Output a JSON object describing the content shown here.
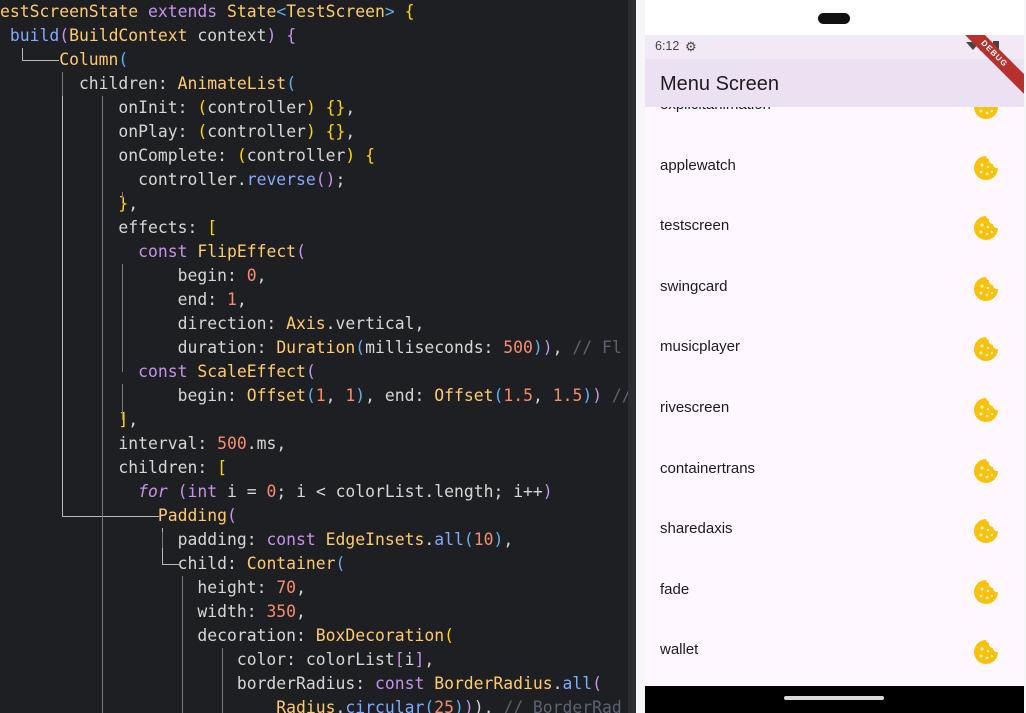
{
  "code_lines": [
    {
      "indent": 0,
      "tokens": [
        {
          "t": "estScreenState ",
          "c": "ty"
        },
        {
          "t": "extends ",
          "c": "kw"
        },
        {
          "t": "State",
          "c": "ty"
        },
        {
          "t": "<",
          "c": "br3"
        },
        {
          "t": "TestScreen",
          "c": "ty"
        },
        {
          "t": "> ",
          "c": "br3"
        },
        {
          "t": "{",
          "c": "br"
        }
      ]
    },
    {
      "indent": 0,
      "tokens": [
        {
          "t": " build",
          "c": "fn"
        },
        {
          "t": "(",
          "c": "br2"
        },
        {
          "t": "BuildContext ",
          "c": "ty"
        },
        {
          "t": "context",
          "c": ""
        },
        {
          "t": ") ",
          "c": "br2"
        },
        {
          "t": "{",
          "c": "br2"
        }
      ]
    },
    {
      "indent": 0,
      "tokens": [
        {
          "t": "      Column",
          "c": "ty"
        },
        {
          "t": "(",
          "c": "br3"
        }
      ]
    },
    {
      "indent": 0,
      "tokens": [
        {
          "t": "        children: ",
          "c": ""
        },
        {
          "t": "AnimateList",
          "c": "ty"
        },
        {
          "t": "(",
          "c": "br3"
        }
      ]
    },
    {
      "indent": 0,
      "tokens": [
        {
          "t": "            onInit: ",
          "c": ""
        },
        {
          "t": "(",
          "c": "br"
        },
        {
          "t": "controller",
          "c": ""
        },
        {
          "t": ") {}",
          "c": "br"
        },
        {
          "t": ",",
          "c": ""
        }
      ]
    },
    {
      "indent": 0,
      "tokens": [
        {
          "t": "            onPlay: ",
          "c": ""
        },
        {
          "t": "(",
          "c": "br"
        },
        {
          "t": "controller",
          "c": ""
        },
        {
          "t": ") {}",
          "c": "br"
        },
        {
          "t": ",",
          "c": ""
        }
      ]
    },
    {
      "indent": 0,
      "tokens": [
        {
          "t": "            onComplete: ",
          "c": ""
        },
        {
          "t": "(",
          "c": "br"
        },
        {
          "t": "controller",
          "c": ""
        },
        {
          "t": ") {",
          "c": "br"
        }
      ]
    },
    {
      "indent": 0,
      "tokens": [
        {
          "t": "              controller.",
          "c": ""
        },
        {
          "t": "reverse",
          "c": "fn"
        },
        {
          "t": "()",
          "c": "br2"
        },
        {
          "t": ";",
          "c": ""
        }
      ]
    },
    {
      "indent": 0,
      "tokens": [
        {
          "t": "            }",
          "c": "br"
        },
        {
          "t": ",",
          "c": ""
        }
      ]
    },
    {
      "indent": 0,
      "tokens": [
        {
          "t": "            effects: ",
          "c": ""
        },
        {
          "t": "[",
          "c": "br"
        }
      ]
    },
    {
      "indent": 0,
      "tokens": [
        {
          "t": "              ",
          "c": ""
        },
        {
          "t": "const ",
          "c": "kw"
        },
        {
          "t": "FlipEffect",
          "c": "ty"
        },
        {
          "t": "(",
          "c": "br2"
        }
      ]
    },
    {
      "indent": 0,
      "tokens": [
        {
          "t": "                  begin: ",
          "c": ""
        },
        {
          "t": "0",
          "c": "num"
        },
        {
          "t": ",",
          "c": ""
        }
      ]
    },
    {
      "indent": 0,
      "tokens": [
        {
          "t": "                  end: ",
          "c": ""
        },
        {
          "t": "1",
          "c": "num"
        },
        {
          "t": ",",
          "c": ""
        }
      ]
    },
    {
      "indent": 0,
      "tokens": [
        {
          "t": "                  direction: ",
          "c": ""
        },
        {
          "t": "Axis",
          "c": "ty"
        },
        {
          "t": ".vertical,",
          "c": ""
        }
      ]
    },
    {
      "indent": 0,
      "tokens": [
        {
          "t": "                  duration: ",
          "c": ""
        },
        {
          "t": "Duration",
          "c": "ty"
        },
        {
          "t": "(",
          "c": "br3"
        },
        {
          "t": "milliseconds: ",
          "c": ""
        },
        {
          "t": "500",
          "c": "num"
        },
        {
          "t": ")",
          "c": "br3"
        },
        {
          "t": ")",
          "c": "br2"
        },
        {
          "t": ", ",
          "c": ""
        },
        {
          "t": "// Fl",
          "c": "cm"
        }
      ]
    },
    {
      "indent": 0,
      "tokens": [
        {
          "t": "              ",
          "c": ""
        },
        {
          "t": "const ",
          "c": "kw"
        },
        {
          "t": "ScaleEffect",
          "c": "ty"
        },
        {
          "t": "(",
          "c": "br2"
        }
      ]
    },
    {
      "indent": 0,
      "tokens": [
        {
          "t": "                  begin: ",
          "c": ""
        },
        {
          "t": "Offset",
          "c": "ty"
        },
        {
          "t": "(",
          "c": "br3"
        },
        {
          "t": "1",
          "c": "num"
        },
        {
          "t": ", ",
          "c": ""
        },
        {
          "t": "1",
          "c": "num"
        },
        {
          "t": ")",
          "c": "br3"
        },
        {
          "t": ", end: ",
          "c": ""
        },
        {
          "t": "Offset",
          "c": "ty"
        },
        {
          "t": "(",
          "c": "br3"
        },
        {
          "t": "1.5",
          "c": "num"
        },
        {
          "t": ", ",
          "c": ""
        },
        {
          "t": "1.5",
          "c": "num"
        },
        {
          "t": ")",
          "c": "br3"
        },
        {
          "t": ")",
          "c": "br2"
        },
        {
          "t": " //",
          "c": "cm"
        }
      ]
    },
    {
      "indent": 0,
      "tokens": [
        {
          "t": "            ]",
          "c": "br"
        },
        {
          "t": ",",
          "c": ""
        }
      ]
    },
    {
      "indent": 0,
      "tokens": [
        {
          "t": "            interval: ",
          "c": ""
        },
        {
          "t": "500",
          "c": "num"
        },
        {
          "t": ".ms,",
          "c": ""
        }
      ]
    },
    {
      "indent": 0,
      "tokens": [
        {
          "t": "            children: ",
          "c": ""
        },
        {
          "t": "[",
          "c": "br"
        }
      ]
    },
    {
      "indent": 0,
      "tokens": [
        {
          "t": "              ",
          "c": ""
        },
        {
          "t": "for ",
          "c": "kw it"
        },
        {
          "t": "(",
          "c": "br2"
        },
        {
          "t": "int ",
          "c": "kw"
        },
        {
          "t": "i = ",
          "c": ""
        },
        {
          "t": "0",
          "c": "num"
        },
        {
          "t": "; i < colorList.length; i++",
          "c": ""
        },
        {
          "t": ")",
          "c": "br2"
        }
      ]
    },
    {
      "indent": 0,
      "tokens": [
        {
          "t": "                Padding",
          "c": "ty"
        },
        {
          "t": "(",
          "c": "br2"
        }
      ]
    },
    {
      "indent": 0,
      "tokens": [
        {
          "t": "                  padding: ",
          "c": ""
        },
        {
          "t": "const ",
          "c": "kw"
        },
        {
          "t": "EdgeInsets",
          "c": "ty"
        },
        {
          "t": ".",
          "c": ""
        },
        {
          "t": "all",
          "c": "fn"
        },
        {
          "t": "(",
          "c": "br3"
        },
        {
          "t": "10",
          "c": "num"
        },
        {
          "t": ")",
          "c": "br3"
        },
        {
          "t": ",",
          "c": ""
        }
      ]
    },
    {
      "indent": 0,
      "tokens": [
        {
          "t": "                  child: ",
          "c": ""
        },
        {
          "t": "Container",
          "c": "ty"
        },
        {
          "t": "(",
          "c": "br3"
        }
      ]
    },
    {
      "indent": 0,
      "tokens": [
        {
          "t": "                    height: ",
          "c": ""
        },
        {
          "t": "70",
          "c": "num"
        },
        {
          "t": ",",
          "c": ""
        }
      ]
    },
    {
      "indent": 0,
      "tokens": [
        {
          "t": "                    width: ",
          "c": ""
        },
        {
          "t": "350",
          "c": "num"
        },
        {
          "t": ",",
          "c": ""
        }
      ]
    },
    {
      "indent": 0,
      "tokens": [
        {
          "t": "                    decoration: ",
          "c": ""
        },
        {
          "t": "BoxDecoration",
          "c": "ty"
        },
        {
          "t": "(",
          "c": "br"
        }
      ]
    },
    {
      "indent": 0,
      "tokens": [
        {
          "t": "                        color: colorList",
          "c": ""
        },
        {
          "t": "[",
          "c": "br2"
        },
        {
          "t": "i",
          "c": ""
        },
        {
          "t": "]",
          "c": "br2"
        },
        {
          "t": ",",
          "c": ""
        }
      ]
    },
    {
      "indent": 0,
      "tokens": [
        {
          "t": "                        borderRadius: ",
          "c": ""
        },
        {
          "t": "const ",
          "c": "kw"
        },
        {
          "t": "BorderRadius",
          "c": "ty"
        },
        {
          "t": ".",
          "c": ""
        },
        {
          "t": "all",
          "c": "fn"
        },
        {
          "t": "(",
          "c": "br2"
        }
      ]
    },
    {
      "indent": 0,
      "tokens": [
        {
          "t": "                            Radius",
          "c": "ty"
        },
        {
          "t": ".",
          "c": ""
        },
        {
          "t": "circular",
          "c": "fn"
        },
        {
          "t": "(",
          "c": "br3"
        },
        {
          "t": "25",
          "c": "num"
        },
        {
          "t": ")",
          "c": "br3"
        },
        {
          "t": ")",
          "c": "br2"
        },
        {
          "t": "), ",
          "c": ""
        },
        {
          "t": "// BorderRad",
          "c": "cm"
        }
      ]
    }
  ],
  "phone": {
    "time": "6:12",
    "status_gear": "⚙",
    "title": "Menu Screen",
    "debug_banner": "DEBUG",
    "items": [
      {
        "label": "explicitanimation"
      },
      {
        "label": "applewatch"
      },
      {
        "label": "testscreen"
      },
      {
        "label": "swingcard"
      },
      {
        "label": "musicplayer"
      },
      {
        "label": "rivescreen"
      },
      {
        "label": "containertrans"
      },
      {
        "label": "sharedaxis"
      },
      {
        "label": "fade"
      },
      {
        "label": "wallet"
      }
    ],
    "item_icon": "cookie-icon",
    "colors": {
      "cookie": "#f9c10c",
      "cookie_chip": "#fff4c4",
      "appbar": "#ece1f3",
      "screen_bg": "#fef7ff"
    }
  }
}
